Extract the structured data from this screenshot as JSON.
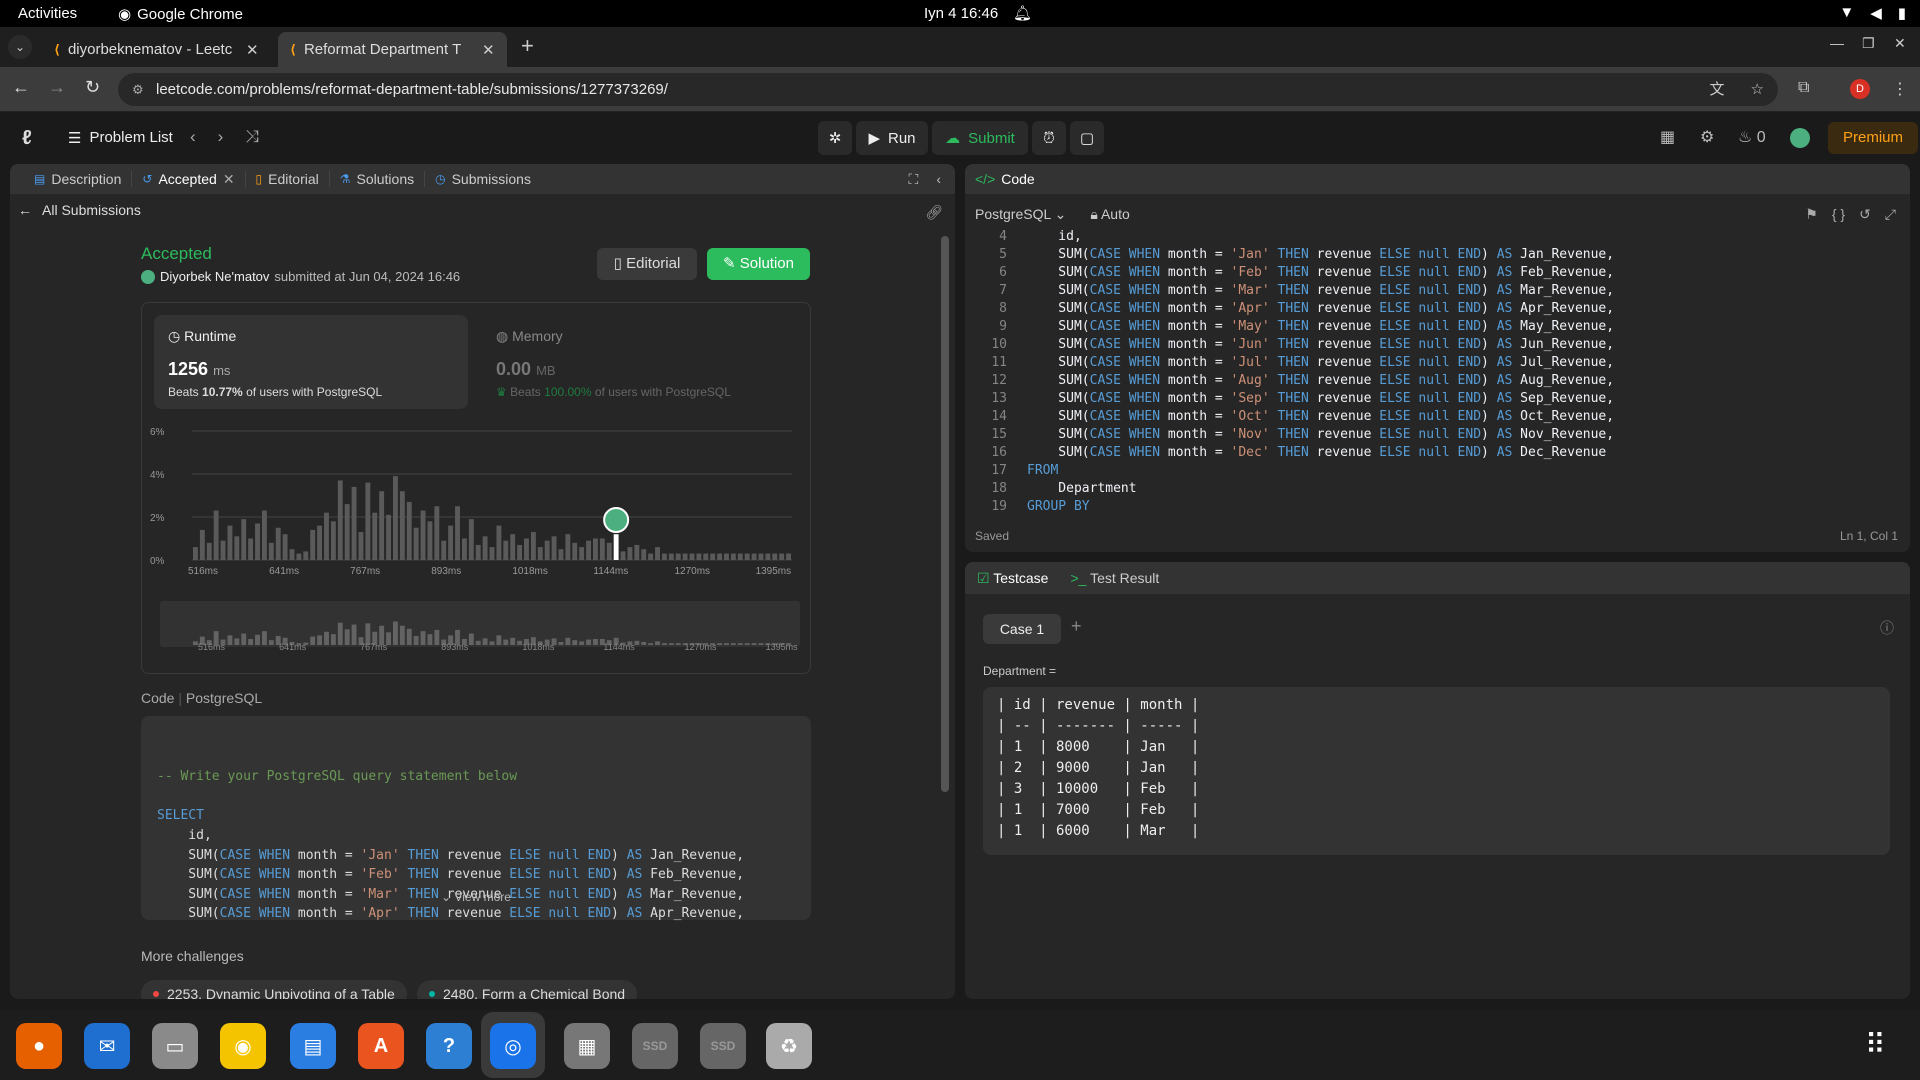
{
  "os": {
    "activities": "Activities",
    "app": "Google Chrome",
    "clock": "Iyn 4  16:46"
  },
  "tabs": [
    {
      "title": "diyorbeknematov - Leetc"
    },
    {
      "title": "Reformat Department T"
    }
  ],
  "url": "leetcode.com/problems/reformat-department-table/submissions/1277373269/",
  "profile_initial": "D",
  "lc": {
    "problem_list": "Problem List",
    "run": "Run",
    "submit": "Submit",
    "streak": "0",
    "premium": "Premium"
  },
  "left": {
    "tabs": [
      "Description",
      "Accepted",
      "Editorial",
      "Solutions",
      "Submissions"
    ],
    "all_submissions": "All Submissions",
    "status": "Accepted",
    "user": "Diyorbek Ne'matov",
    "submitted_text": "submitted at Jun 04, 2024 16:46",
    "editorial_btn": "Editorial",
    "solution_btn": "Solution",
    "runtime": {
      "label": "Runtime",
      "value": "1256",
      "unit": "ms",
      "beats_prefix": "Beats",
      "beats_value": "10.77%",
      "beats_suffix": "of users with PostgreSQL"
    },
    "memory": {
      "label": "Memory",
      "value": "0.00",
      "unit": "MB",
      "beats_prefix": "Beats",
      "beats_value": "100.00%",
      "beats_suffix": "of users with PostgreSQL"
    },
    "code_header": "Code",
    "code_lang": "PostgreSQL",
    "view_more": "View more",
    "more_challenges": "More challenges",
    "challenges": [
      {
        "title": "2253. Dynamic Unpivoting of a Table",
        "color": "#ef4743"
      },
      {
        "title": "2480. Form a Chemical Bond",
        "color": "#00b8a3"
      }
    ]
  },
  "chart_data": {
    "type": "bar",
    "ylabel_ticks": [
      "6%",
      "4%",
      "2%",
      "0%"
    ],
    "ylim": [
      0,
      6
    ],
    "xticks": [
      "516ms",
      "641ms",
      "767ms",
      "893ms",
      "1018ms",
      "1144ms",
      "1270ms",
      "1395ms"
    ],
    "highlight_value": "1256ms",
    "values": [
      0.6,
      1.4,
      0.8,
      2.3,
      0.9,
      1.6,
      1.1,
      1.9,
      1.0,
      1.7,
      2.3,
      0.8,
      1.5,
      1.2,
      0.5,
      0.3,
      0.4,
      1.4,
      1.6,
      2.2,
      1.8,
      3.7,
      2.6,
      3.4,
      1.3,
      3.6,
      2.2,
      3.2,
      2.1,
      3.9,
      3.2,
      2.7,
      1.5,
      2.3,
      1.8,
      2.5,
      0.9,
      1.6,
      2.5,
      1.0,
      1.9,
      0.7,
      1.1,
      0.6,
      1.6,
      0.9,
      1.2,
      0.7,
      1.0,
      1.3,
      0.6,
      0.9,
      1.1,
      0.5,
      1.2,
      0.8,
      0.6,
      0.9,
      1.0,
      1.0,
      0.8,
      1.2,
      0.4,
      0.6,
      0.7,
      0.5,
      0.3,
      0.6,
      0.3,
      0.3,
      0.3,
      0.3,
      0.3,
      0.3,
      0.3,
      0.3,
      0.3,
      0.3,
      0.3,
      0.3,
      0.3,
      0.3,
      0.3,
      0.3,
      0.3,
      0.3,
      0.3
    ],
    "highlight_index": 61
  },
  "left_code": [
    {
      "t": "-- Write your PostgreSQL query statement below",
      "k": "cm"
    },
    {
      "t": "",
      "k": ""
    },
    {
      "t": "SELECT",
      "k": "kw"
    },
    {
      "t": "    id,",
      "k": ""
    },
    {
      "m": "Jan"
    },
    {
      "m": "Feb"
    },
    {
      "m": "Mar"
    },
    {
      "m": "Apr"
    }
  ],
  "right": {
    "title": "Code",
    "lang": "PostgreSQL",
    "auto": "Auto",
    "start_line": 4,
    "lines": [
      {
        "t": "    id,"
      },
      {
        "m": "Jan"
      },
      {
        "m": "Feb"
      },
      {
        "m": "Mar"
      },
      {
        "m": "Apr"
      },
      {
        "m": "May"
      },
      {
        "m": "Jun"
      },
      {
        "m": "Jul"
      },
      {
        "m": "Aug"
      },
      {
        "m": "Sep"
      },
      {
        "m": "Oct"
      },
      {
        "m": "Nov"
      },
      {
        "m": "Dec",
        "last": true
      },
      {
        "t": "FROM",
        "k": "kw"
      },
      {
        "t": "    Department"
      },
      {
        "t": "GROUP BY",
        "k": "kw"
      }
    ],
    "saved": "Saved",
    "cursor": "Ln 1, Col 1"
  },
  "test": {
    "tab_testcase": "Testcase",
    "tab_result": "Test Result",
    "case": "Case 1",
    "label": "Department =",
    "table": "| id | revenue | month |\n| -- | ------- | ----- |\n| 1  | 8000    | Jan   |\n| 2  | 9000    | Jan   |\n| 3  | 10000   | Feb   |\n| 1  | 7000    | Feb   |\n| 1  | 6000    | Mar   |"
  },
  "dock": [
    {
      "name": "firefox",
      "color": "#e66000",
      "glyph": "●"
    },
    {
      "name": "thunderbird",
      "color": "#1f6fd0",
      "glyph": "✉"
    },
    {
      "name": "files",
      "color": "#8a8a8a",
      "glyph": "▭"
    },
    {
      "name": "rhythmbox",
      "color": "#f5c400",
      "glyph": "◉"
    },
    {
      "name": "writer",
      "color": "#2a7de1",
      "glyph": "▤"
    },
    {
      "name": "app-center",
      "color": "#e9541f",
      "glyph": "A"
    },
    {
      "name": "help",
      "color": "#2d7fd3",
      "glyph": "?"
    },
    {
      "name": "chrome",
      "color": "#1a73e8",
      "glyph": "◎"
    },
    {
      "name": "drive",
      "color": "#777",
      "glyph": "▦"
    },
    {
      "name": "ssd-1",
      "color": "#666",
      "glyph": "SSD"
    },
    {
      "name": "ssd-2",
      "color": "#666",
      "glyph": "SSD"
    },
    {
      "name": "trash",
      "color": "#aaa",
      "glyph": "♻"
    }
  ]
}
